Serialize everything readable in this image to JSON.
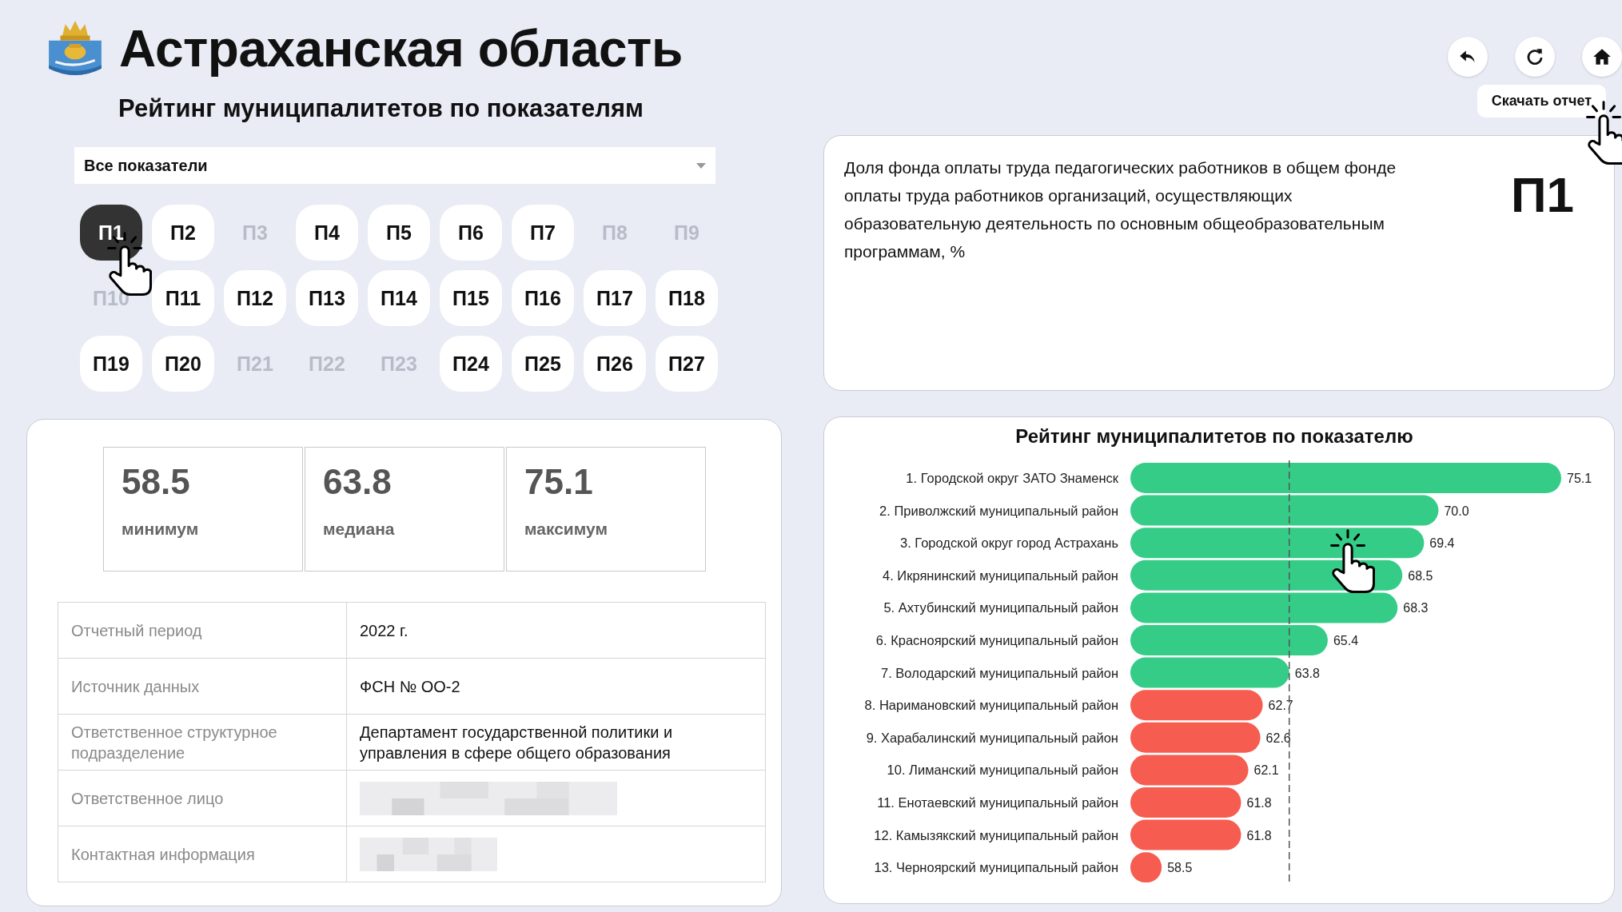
{
  "header": {
    "title": "Астраханская область",
    "subtitle": "Рейтинг муниципалитетов по показателям"
  },
  "filter": {
    "value": "Все показатели"
  },
  "indicators": [
    {
      "label": "П1",
      "selected": true,
      "disabled": false
    },
    {
      "label": "П2",
      "selected": false,
      "disabled": false
    },
    {
      "label": "П3",
      "selected": false,
      "disabled": true
    },
    {
      "label": "П4",
      "selected": false,
      "disabled": false
    },
    {
      "label": "П5",
      "selected": false,
      "disabled": false
    },
    {
      "label": "П6",
      "selected": false,
      "disabled": false
    },
    {
      "label": "П7",
      "selected": false,
      "disabled": false
    },
    {
      "label": "П8",
      "selected": false,
      "disabled": true
    },
    {
      "label": "П9",
      "selected": false,
      "disabled": true
    },
    {
      "label": "П10",
      "selected": false,
      "disabled": true
    },
    {
      "label": "П11",
      "selected": false,
      "disabled": false
    },
    {
      "label": "П12",
      "selected": false,
      "disabled": false
    },
    {
      "label": "П13",
      "selected": false,
      "disabled": false
    },
    {
      "label": "П14",
      "selected": false,
      "disabled": false
    },
    {
      "label": "П15",
      "selected": false,
      "disabled": false
    },
    {
      "label": "П16",
      "selected": false,
      "disabled": false
    },
    {
      "label": "П17",
      "selected": false,
      "disabled": false
    },
    {
      "label": "П18",
      "selected": false,
      "disabled": false
    },
    {
      "label": "П19",
      "selected": false,
      "disabled": false
    },
    {
      "label": "П20",
      "selected": false,
      "disabled": false
    },
    {
      "label": "П21",
      "selected": false,
      "disabled": true
    },
    {
      "label": "П22",
      "selected": false,
      "disabled": true
    },
    {
      "label": "П23",
      "selected": false,
      "disabled": true
    },
    {
      "label": "П24",
      "selected": false,
      "disabled": false
    },
    {
      "label": "П25",
      "selected": false,
      "disabled": false
    },
    {
      "label": "П26",
      "selected": false,
      "disabled": false
    },
    {
      "label": "П27",
      "selected": false,
      "disabled": false
    }
  ],
  "stats": [
    {
      "value": "58.5",
      "label": "минимум"
    },
    {
      "value": "63.8",
      "label": "медиана"
    },
    {
      "value": "75.1",
      "label": "максимум"
    }
  ],
  "info": [
    {
      "label": "Отчетный период",
      "value": "2022 г.",
      "redacted": false
    },
    {
      "label": "Источник данных",
      "value": "ФСН № ОО-2",
      "redacted": false
    },
    {
      "label": "Ответственное структурное подразделение",
      "value": "Департамент государственной политики и управления в сфере общего образования",
      "redacted": false
    },
    {
      "label": "Ответственное лицо",
      "redacted": true
    },
    {
      "label": "Контактная информация",
      "redacted": true
    }
  ],
  "toolbar": {
    "tooltip": "Скачать отчет"
  },
  "indicator": {
    "code": "П1",
    "description": "Доля фонда оплаты труда педагогических работников в общем фонде оплаты труда работников организаций, осуществляющих образовательную деятельность по основным общеобразовательным программам, %"
  },
  "chart": {
    "chart_data": {
      "type": "bar",
      "orientation": "horizontal",
      "title": "Рейтинг муниципалитетов по показателю",
      "categories": [
        "1. Городской округ ЗАТО Знаменск",
        "2. Приволжский муниципальный район",
        "3. Городской округ город Астрахань",
        "4. Икрянинский муниципальный район",
        "5. Ахтубинский муниципальный район",
        "6. Красноярский муниципальный район",
        "7. Володарский муниципальный район",
        "8. Наримановский муниципальный район",
        "9. Харабалинский муниципальный район",
        "10. Лиманский муниципальный район",
        "11. Енотаевский муниципальный район",
        "12. Камызякский муниципальный район",
        "13. Черноярский муниципальный район"
      ],
      "series": [
        {
          "color": "#35cc88",
          "values": [
            75.1,
            70.0,
            69.4,
            68.5,
            68.3,
            65.4,
            63.8,
            null,
            null,
            null,
            null,
            null,
            null
          ],
          "value_labels": [
            "75.1",
            "70.0",
            "69.4",
            "68.5",
            "68.3",
            "65.4",
            "63.8",
            null,
            null,
            null,
            null,
            null,
            null
          ]
        },
        {
          "color": "#f65c50",
          "values": [
            null,
            null,
            null,
            null,
            null,
            null,
            null,
            62.7,
            62.6,
            62.1,
            61.8,
            61.8,
            58.5
          ],
          "value_labels": [
            null,
            null,
            null,
            null,
            null,
            null,
            null,
            "62.7",
            "62.6",
            "62.1",
            "61.8",
            "61.8",
            "58.5"
          ]
        }
      ],
      "xlim": [
        57.2,
        75.1
      ],
      "data_labels": true,
      "ref_lines": [
        {
          "axis": "x",
          "value": 63.8
        }
      ]
    }
  }
}
